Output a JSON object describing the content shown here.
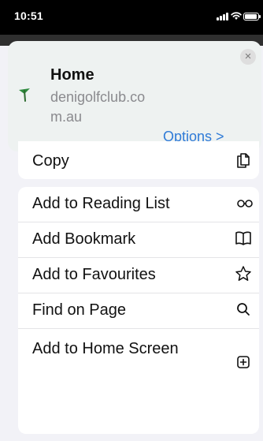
{
  "status_bar": {
    "time": "10:51",
    "icons": [
      "signal-icon",
      "wifi-icon",
      "battery-icon"
    ]
  },
  "header": {
    "title": "Home",
    "domain": "denigolfclub.com.au",
    "options_label": "Options >",
    "close_label": "×",
    "site_icon": "golf-flag-icon",
    "accent_color": "#2f7bd7"
  },
  "actions": {
    "copy": {
      "label": "Copy",
      "icon": "copy-icon"
    },
    "items": [
      {
        "label": "Add to Reading List",
        "icon": "glasses-icon"
      },
      {
        "label": "Add Bookmark",
        "icon": "book-icon"
      },
      {
        "label": "Add to Favourites",
        "icon": "star-icon"
      },
      {
        "label": "Find on Page",
        "icon": "search-icon"
      },
      {
        "label": "Add to Home Screen",
        "icon": "plus-square-icon"
      }
    ]
  }
}
